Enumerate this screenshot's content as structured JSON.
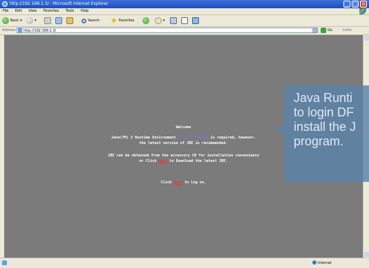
{
  "window": {
    "title": "http://192.168.1.3/ - Microsoft Internet Explorer",
    "controls": [
      "_",
      "□",
      "×"
    ]
  },
  "menu": [
    "File",
    "Edit",
    "View",
    "Favorites",
    "Tools",
    "Help"
  ],
  "toolbar": {
    "back_label": "Back",
    "search_label": "Search",
    "favorites_label": "Favorites"
  },
  "address": {
    "label": "Address",
    "url": "http://192.168.1.3/",
    "go_label": "Go",
    "links_label": "Links"
  },
  "page": {
    "welcome": "Welcome",
    "jre_line1_a": "Java(TM) 2 Runtime Environment ",
    "jre_version": "1.4.2 or above",
    "jre_line1_b": " is required, however,",
    "jre_line2": "the latest version of JRE is recommended.",
    "cd_line1": "JRE can be obtained from the accessory CD for installation convenience",
    "cd_line2_a": "or Click ",
    "here1": "here",
    "cd_line2_b": " to Download the latest JRE.",
    "login_a": "Click ",
    "here2": "here",
    "login_b": " to Log on."
  },
  "callout": {
    "line1": "Java Runti",
    "line2": "to login DF",
    "line3": "install the J",
    "line4": "program."
  },
  "status": {
    "zone": "Internet"
  },
  "colors": {
    "content_bg": "#7b7b7b",
    "link_red": "#ff2a2a",
    "version_blue": "#7d6fe8",
    "callout_bg": "#5c82aa"
  }
}
